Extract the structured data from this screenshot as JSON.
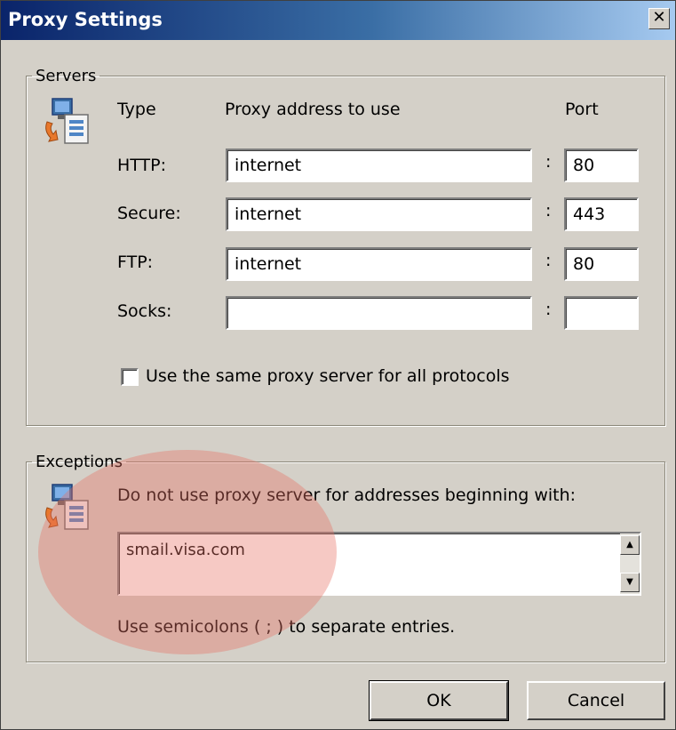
{
  "window": {
    "title": "Proxy Settings",
    "close_glyph": "✕"
  },
  "servers": {
    "legend": "Servers",
    "icon": "network-computer-icon",
    "col_type": "Type",
    "col_address": "Proxy address to use",
    "col_port": "Port",
    "rows": [
      {
        "label": "HTTP:",
        "address": "internet",
        "port": "80"
      },
      {
        "label": "Secure:",
        "address": "internet",
        "port": "443"
      },
      {
        "label": "FTP:",
        "address": "internet",
        "port": "80"
      },
      {
        "label": "Socks:",
        "address": "",
        "port": ""
      }
    ],
    "colon": ":",
    "same_proxy_label": "Use the same proxy server for all protocols",
    "same_proxy_checked": false
  },
  "exceptions": {
    "legend": "Exceptions",
    "icon": "network-computer-icon",
    "instruction": "Do not use proxy server for addresses beginning with:",
    "value": "smail.visa.com",
    "hint": "Use semicolons ( ; ) to separate entries."
  },
  "buttons": {
    "ok": "OK",
    "cancel": "Cancel"
  },
  "highlight_color": "#e87064"
}
